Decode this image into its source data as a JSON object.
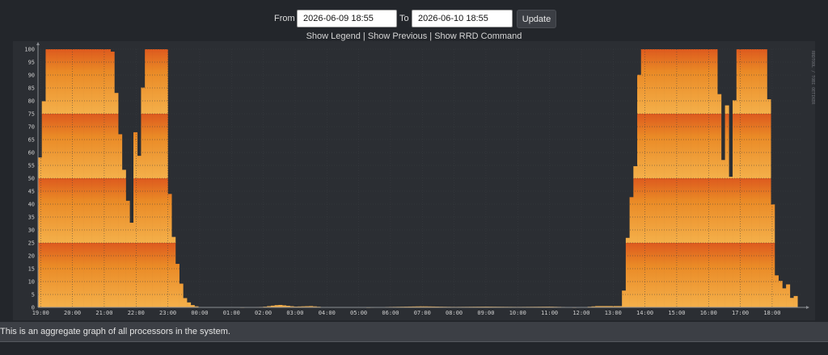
{
  "controls": {
    "from_label": "From",
    "from_value": "2026-06-09 18:55",
    "to_label": "To",
    "to_value": "2026-06-10 18:55",
    "update_label": "Update"
  },
  "links": {
    "show_legend": "Show Legend",
    "show_previous": "Show Previous",
    "show_rrd_command": "Show RRD Command",
    "separator": "|"
  },
  "graph": {
    "watermark": "RRDTOOL / TOBI OETIKER",
    "colors": {
      "background": "#2b2e33",
      "canvas": "#2b2e33",
      "grid": "#3a3d42",
      "band_dark": "#dd5a1e",
      "band_mid": "#ea8a26",
      "band_light": "#f4b04a"
    }
  },
  "chart_data": {
    "type": "area",
    "stacked": true,
    "x_ticks": [
      "19:00",
      "20:00",
      "21:00",
      "22:00",
      "23:00",
      "00:00",
      "01:00",
      "02:00",
      "03:00",
      "04:00",
      "05:00",
      "06:00",
      "07:00",
      "08:00",
      "09:00",
      "10:00",
      "11:00",
      "12:00",
      "13:00",
      "14:00",
      "15:00",
      "16:00",
      "17:00",
      "18:00"
    ],
    "y_ticks": [
      0,
      5,
      10,
      15,
      20,
      25,
      30,
      35,
      40,
      45,
      50,
      55,
      60,
      65,
      70,
      75,
      80,
      85,
      90,
      95,
      100
    ],
    "ylim": [
      0,
      100
    ],
    "xlim_hours": [
      18.917,
      42.917
    ],
    "grid": true,
    "series_bands": [
      0,
      25,
      50,
      75,
      100
    ],
    "points": [
      [
        18.92,
        55
      ],
      [
        19.05,
        62
      ],
      [
        19.15,
        100
      ],
      [
        20.0,
        100
      ],
      [
        21.0,
        100
      ],
      [
        21.25,
        100
      ],
      [
        21.4,
        80
      ],
      [
        21.55,
        60
      ],
      [
        21.7,
        45
      ],
      [
        21.85,
        30
      ],
      [
        21.95,
        70
      ],
      [
        22.05,
        62
      ],
      [
        22.15,
        55
      ],
      [
        22.25,
        100
      ],
      [
        22.95,
        100
      ],
      [
        23.05,
        45
      ],
      [
        23.15,
        30
      ],
      [
        23.25,
        20
      ],
      [
        23.4,
        10
      ],
      [
        23.55,
        3
      ],
      [
        23.75,
        1
      ],
      [
        24.0,
        0
      ],
      [
        25.0,
        0
      ],
      [
        26.0,
        0.2
      ],
      [
        26.5,
        1
      ],
      [
        27.0,
        0.3
      ],
      [
        27.5,
        0.5
      ],
      [
        28.0,
        0
      ],
      [
        29.0,
        0
      ],
      [
        30.0,
        0.2
      ],
      [
        31.0,
        0.4
      ],
      [
        32.0,
        0.2
      ],
      [
        33.0,
        0.3
      ],
      [
        34.0,
        0.2
      ],
      [
        35.0,
        0.3
      ],
      [
        36.0,
        0
      ],
      [
        36.5,
        0.5
      ],
      [
        37.3,
        0.5
      ],
      [
        37.42,
        20
      ],
      [
        37.5,
        35
      ],
      [
        37.6,
        45
      ],
      [
        37.7,
        55
      ],
      [
        37.85,
        100
      ],
      [
        39.0,
        100
      ],
      [
        40.25,
        100
      ],
      [
        40.35,
        80
      ],
      [
        40.45,
        55
      ],
      [
        40.55,
        85
      ],
      [
        40.65,
        60
      ],
      [
        40.75,
        40
      ],
      [
        40.85,
        100
      ],
      [
        41.8,
        100
      ],
      [
        41.9,
        80
      ],
      [
        42.0,
        45
      ],
      [
        42.1,
        15
      ],
      [
        42.2,
        8
      ],
      [
        42.3,
        12
      ],
      [
        42.4,
        6
      ],
      [
        42.5,
        9
      ],
      [
        42.6,
        3
      ],
      [
        42.7,
        7
      ],
      [
        42.8,
        0
      ]
    ]
  },
  "footer": {
    "description": "This is an aggregate graph of all processors in the system."
  }
}
